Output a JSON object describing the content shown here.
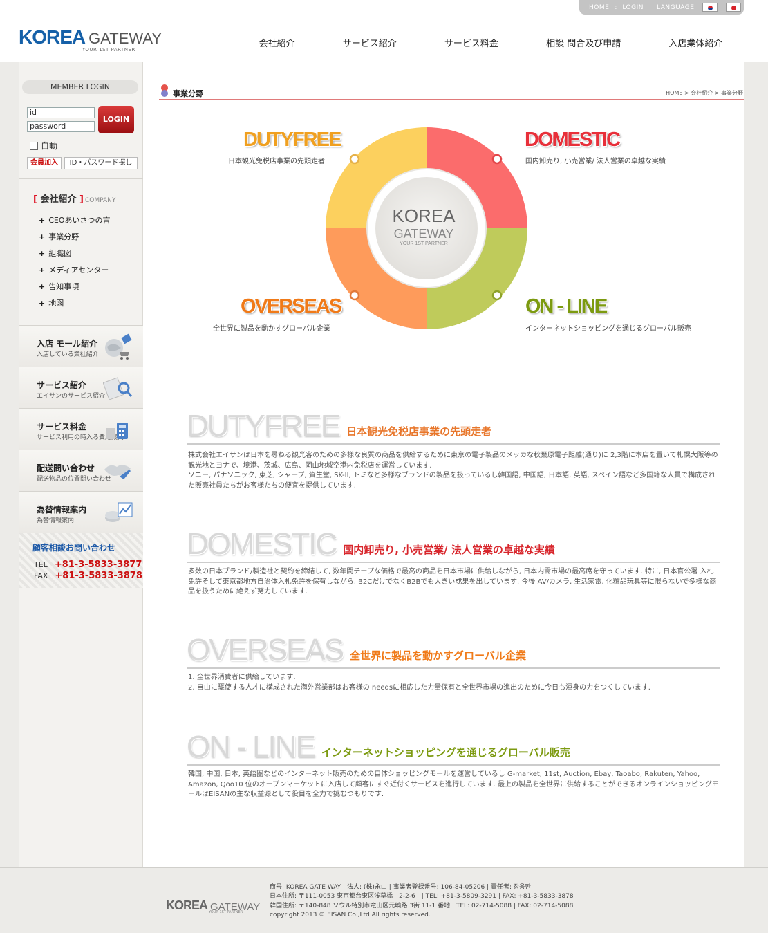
{
  "header": {
    "top_links": [
      "HOME",
      ":",
      "LOGIN",
      ":",
      "LANGUAGE"
    ],
    "logo_main": "KOREA",
    "logo_secondary": "GATEWAY",
    "logo_tagline": "YOUR 1ST PARTNER",
    "nav": [
      "会社紹介",
      "サービス紹介",
      "サービス料金",
      "相談 問合及び申請",
      "入店業体紹介"
    ]
  },
  "sidebar": {
    "login_title": "MEMBER LOGIN",
    "id_value": "id",
    "password_value": "password",
    "login_button": "LOGIN",
    "auto_label": "自動",
    "join_button": "会員加入",
    "find_button": "ID・パスワード探し",
    "menu_title": "会社紹介",
    "menu_title_en": "COMPANY",
    "menu_items": [
      "CEOあいさつの言",
      "事業分野",
      "組職図",
      "メディアセンター",
      "告知事項",
      "地図"
    ],
    "boxes": [
      {
        "title": "入店 モール紹介",
        "subtitle": "入店している業社紹介"
      },
      {
        "title": "サービス紹介",
        "subtitle": "エイサンのサービス紹介"
      },
      {
        "title": "サービス料金",
        "subtitle": "サービス利用の時入る費用案内"
      },
      {
        "title": "配送問い合わせ",
        "subtitle": "配送物品の位置問い合わせ"
      },
      {
        "title": "為替情報案内",
        "subtitle": "為替情報案内"
      }
    ],
    "contact": {
      "title": "顧客相談お問い合わせ",
      "tel_label": "TEL",
      "tel": "+81-3-5833-3877",
      "fax_label": "FAX",
      "fax": "+81-3-5833-3878"
    }
  },
  "content": {
    "page_title": "事業分野",
    "breadcrumb": "HOME > 会社紹介 > 事業分野",
    "hero": {
      "center_main": "KOREA",
      "center_secondary": "GATEWAY",
      "center_tagline": "YOUR 1ST PARTNER",
      "labels": [
        {
          "title": "DUTYFREE",
          "desc": "日本観光免税店事業の先頭走者",
          "color": "#f0a020"
        },
        {
          "title": "DOMESTIC",
          "desc": "国内卸売り, 小売営業/ 法人営業の卓越な実績",
          "color": "#e8303a"
        },
        {
          "title": "OVERSEAS",
          "desc": "全世界に製品を動かすグローバル企業",
          "color": "#f07a18"
        },
        {
          "title": "ON - LINE",
          "desc": "インターネットショッピングを通じるグローバル販売",
          "color": "#7c9a10"
        }
      ]
    },
    "sections": [
      {
        "big": "DUTYFREE",
        "sub": "日本観光免税店事業の先頭走者",
        "color": "#e8762a",
        "body": [
          "株式会社エイサンは日本を尋ねる観光客のための多様な良質の商品を供給するために東京の電子製品のメッカな秋葉原電子距離(通り)に 2,3階に本店を置いて札幌大阪等の観光地とヨナで、境港、茨城、広島、岡山地域空港内免税店を運営しています.",
          "ソニー, パナソニック, 東芝, シャープ, 資生堂, SK-II, トミなど多様なブランドの製品を扱っているし韓国語, 中国語, 日本語, 英語, スペイン語など多国籍な人員で構成された販売社員たちがお客様たちの便宜を提供しています."
        ]
      },
      {
        "big": "DOMESTIC",
        "sub": "国内卸売り, 小売営業/ 法人営業の卓越な実績",
        "color": "#d8262c",
        "body": [
          "多数の日本ブランド/製造社と契約を締結して, 数年間チープな価格で最高の商品を日本市場に供給しながら, 日本内需市場の最高席を守っています. 特に, 日本官公署 入札免許そして東京都地方自治体入札免許を保有しながら, B2CだけでなくB2Bでも大きい成果を出しています. 今後 AV/カメラ, 生活家電, 化粧品玩具等に限らないで多様な商品を扱うために絶えず努力しています."
        ]
      },
      {
        "big": "OVERSEAS",
        "sub": "全世界に製品を動かすグローバル企業",
        "color": "#f07a18",
        "body": [
          "1.  全世界消費者に供給しています.",
          "2.  自由に駆使する人才に構成された海外営業部はお客様の needsに相応した力量保有と全世界市場の進出のために今日も渾身の力をつくしています."
        ]
      },
      {
        "big": "ON - LINE",
        "sub": "インターネットショッピングを通じるグローバル販売",
        "color": "#7c9a10",
        "body": [
          "韓国, 中国, 日本, 英語圏などのインターネット販売のための自体ショッピングモールを運営しているし G-market, 11st, Auction, Ebay, Taoabo, Rakuten, Yahoo, Amazon, Qoo10 位のオープンマーケットに入店して顧客にすぐ近付くサービスを進行しています. 最上の製品を全世界に供給することができるオンラインショッピングモールはEISANの主な収益源として役目を全力で挑むつもりです."
        ]
      }
    ]
  },
  "footer": {
    "logo_main": "KOREA",
    "logo_secondary": "GATEWAY",
    "logo_tagline": "YOUR 1ST PARTNER",
    "lines": [
      "商号: KOREA GATE WAY | 法人: (株)永山 | 事業者登録番号: 106-84-05206 | 責任者: 장용한",
      "日本住所: 〒111-0053 東京都台東区浅草橋　2-2-6　| TEL: +81-3-5809-3291 | FAX: +81-3-5833-3878",
      "韓国住所: 〒140-848  ソウル特別市竜山区元曉路 3街 11-1 番地  | TEL: 02-714-5088  | FAX: 02-714-5088",
      "copyright 2013 © EISAN Co.,Ltd  All rights reserved."
    ]
  },
  "colors": {
    "dutyfree": "#fcd05e",
    "domestic": "#fb6c6c",
    "overseas": "#fe9b5b",
    "online": "#bfcb5b",
    "brand_blue": "#1560a8"
  }
}
